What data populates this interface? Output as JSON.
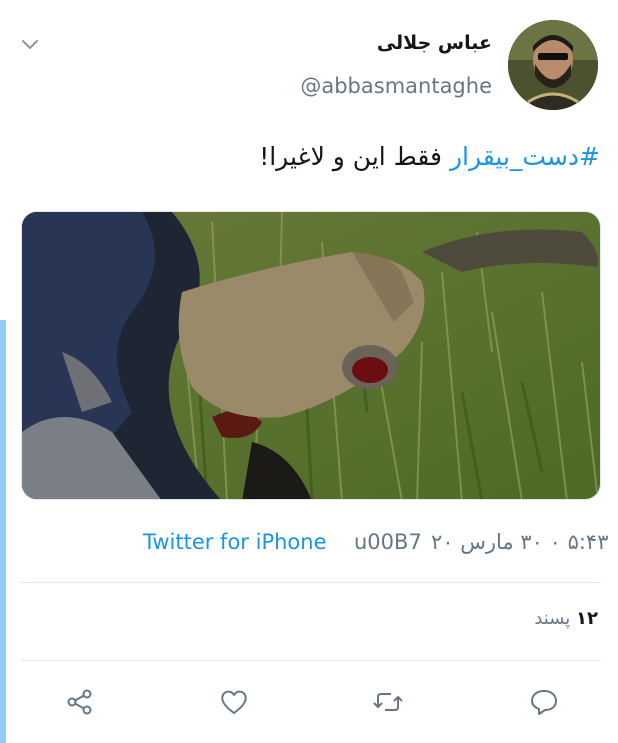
{
  "tweet": {
    "author_name": "عباس جلالی",
    "handle": "@abbasmantaghe",
    "hashtag": "#دست_بیقرار",
    "text": "فقط این و لاغیرا!",
    "source": "Twitter for iPhone",
    "separator": "u00B7",
    "datetime": "۵:۴۳ ۰ ۳۰ مارس ۲۰",
    "likes_count": "۱۲",
    "likes_label": "پسند"
  },
  "icons": {
    "menu": "chevron-down-icon",
    "share": "share-icon",
    "like": "heart-icon",
    "retweet": "retweet-icon",
    "reply": "reply-icon"
  },
  "colors": {
    "accent": "#1b95e0",
    "secondary_text": "#657786",
    "divider": "#e1e8ed",
    "left_bar": "#8ecdf3"
  }
}
